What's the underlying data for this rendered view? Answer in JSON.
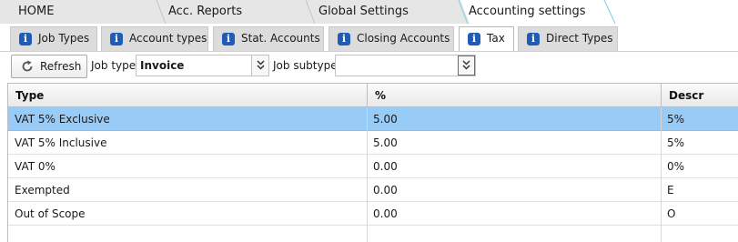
{
  "breadcrumbs": [
    {
      "label": "HOME"
    },
    {
      "label": "Acc. Reports"
    },
    {
      "label": "Global Settings"
    },
    {
      "label": "Accounting settings"
    }
  ],
  "tabs": [
    {
      "label": "Job Types",
      "icon": "info-icon"
    },
    {
      "label": "Account types",
      "icon": "info-icon"
    },
    {
      "label": "Stat. Accounts",
      "icon": "info-icon"
    },
    {
      "label": "Closing Accounts",
      "icon": "info-icon"
    },
    {
      "label": "Tax",
      "icon": "info-icon",
      "active": true
    },
    {
      "label": "Direct Types",
      "icon": "info-icon"
    }
  ],
  "toolbar": {
    "refresh_label": "Refresh",
    "job_type_label": "Job type",
    "job_type_value": "Invoice",
    "job_subtype_label": "Job subtype",
    "job_subtype_value": ""
  },
  "grid": {
    "columns": [
      "Type",
      "%",
      "Descr"
    ],
    "rows": [
      {
        "type": "VAT 5% Exclusive",
        "pct": "5.00",
        "descr": "5%",
        "selected": true
      },
      {
        "type": "VAT 5% Inclusive",
        "pct": "5.00",
        "descr": "5%"
      },
      {
        "type": "VAT 0%",
        "pct": "0.00",
        "descr": "0%"
      },
      {
        "type": "Exempted",
        "pct": "0.00",
        "descr": "E"
      },
      {
        "type": "Out of Scope",
        "pct": "0.00",
        "descr": "O"
      }
    ]
  },
  "colors": {
    "selected_row": "#99cbf7",
    "info_icon": "#1f5cb8",
    "active_tab_edge": "#8fd0e8"
  }
}
